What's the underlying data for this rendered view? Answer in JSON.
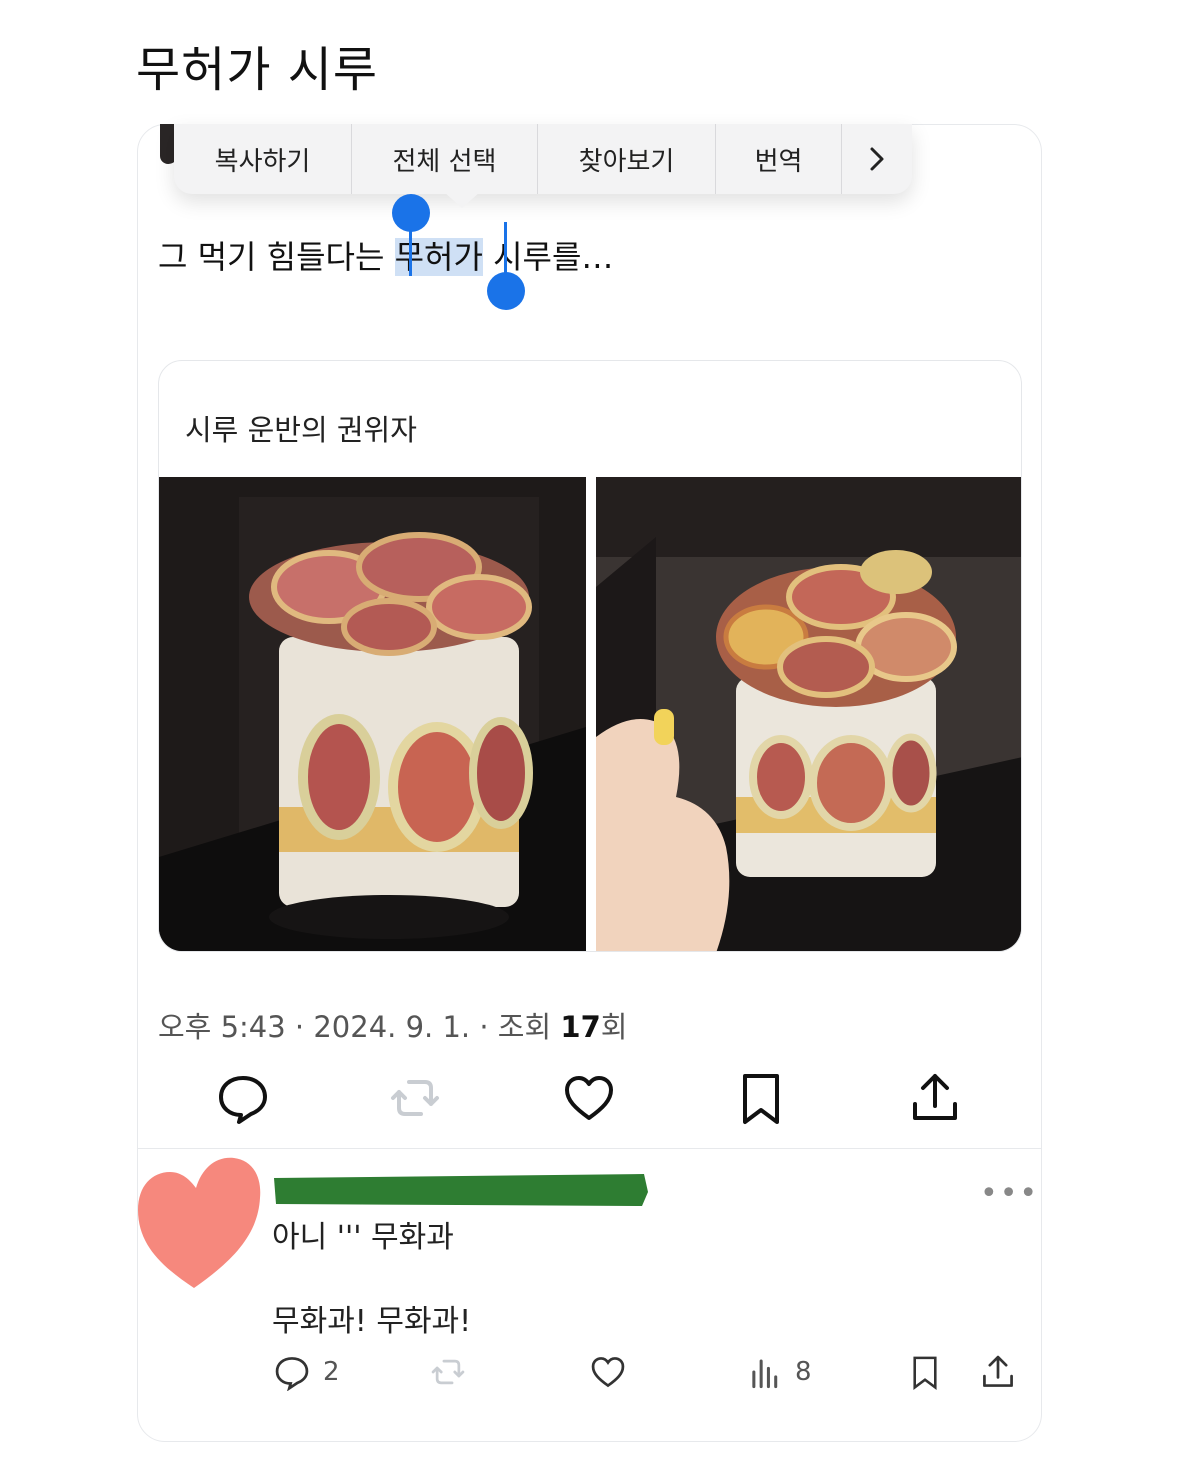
{
  "headline": "무허가 시루",
  "context_menu": {
    "items": [
      "복사하기",
      "전체 선택",
      "찾아보기",
      "번역"
    ],
    "more_icon": "chevron-right-icon"
  },
  "post": {
    "text_before": "그 먹기 힘들다는 ",
    "text_selected": "무허가",
    "text_after": " 시루를…"
  },
  "quote": {
    "text": "시루 운반의 권위자",
    "images": [
      "fig-cake-photo-1",
      "fig-cake-photo-2"
    ]
  },
  "meta": {
    "prefix": "오후 5:43 · 2024. 9. 1. · 조회 ",
    "views": "17",
    "suffix": "회"
  },
  "actions": [
    "reply-icon",
    "repost-icon",
    "like-icon",
    "bookmark-icon",
    "share-icon"
  ],
  "reply": {
    "line1": "아니 ''' 무화과",
    "line2": "무화과! 무화과!",
    "reply_count": "2",
    "views_count": "8"
  },
  "colors": {
    "selection": "#cfe0f5",
    "handle": "#1a73e8",
    "redaction": "#2e7d32",
    "heart": "#f6887d",
    "icon": "#111111",
    "icon_disabled": "#c9cdd2"
  }
}
